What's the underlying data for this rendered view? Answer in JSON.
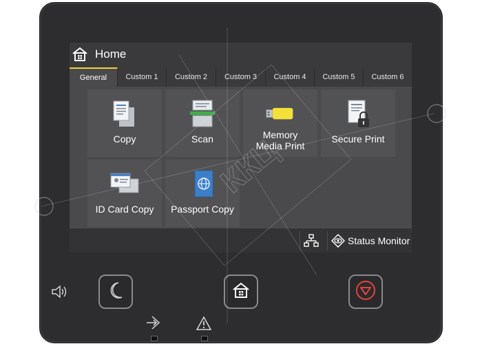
{
  "header": {
    "title": "Home"
  },
  "tabs": [
    {
      "label": "General",
      "active": true
    },
    {
      "label": "Custom 1",
      "active": false
    },
    {
      "label": "Custom 2",
      "active": false
    },
    {
      "label": "Custom 3",
      "active": false
    },
    {
      "label": "Custom 4",
      "active": false
    },
    {
      "label": "Custom 5",
      "active": false
    },
    {
      "label": "Custom 6",
      "active": false
    }
  ],
  "functions": [
    {
      "label": "Copy",
      "icon": "copy-icon"
    },
    {
      "label": "Scan",
      "icon": "scan-icon"
    },
    {
      "label_line1": "Memory",
      "label_line2": "Media Print",
      "icon": "usb-memory-icon"
    },
    {
      "label": "Secure Print",
      "icon": "secure-print-icon"
    },
    {
      "label": "ID Card Copy",
      "icon": "id-card-icon"
    },
    {
      "label": "Passport Copy",
      "icon": "passport-icon"
    }
  ],
  "status_bar": {
    "status_monitor_label": "Status Monitor"
  },
  "watermark_text": "ККЦ",
  "colors": {
    "accent": "#f0d23a",
    "stop": "#e0463a",
    "usb": "#f3e03a"
  }
}
